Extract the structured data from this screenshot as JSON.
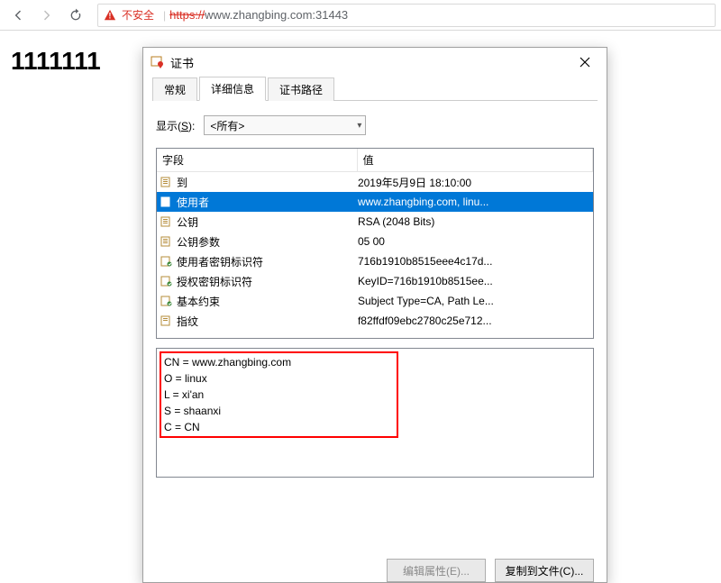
{
  "browser": {
    "insecure_label": "不安全",
    "url_scheme": "https://",
    "url_rest": "www.zhangbing.com:31443"
  },
  "page": {
    "headline": "1111111"
  },
  "dialog": {
    "title": "证书",
    "tabs": {
      "general": "常规",
      "details": "详细信息",
      "path": "证书路径"
    },
    "show_label_pre": "显示(",
    "show_label_u": "S",
    "show_label_post": "):",
    "show_value": "<所有>",
    "header_field": "字段",
    "header_value": "值",
    "rows": [
      {
        "field": "到",
        "value": "2019年5月9日 18:10:00",
        "icon": "file"
      },
      {
        "field": "使用者",
        "value": "www.zhangbing.com, linu...",
        "icon": "file",
        "selected": true
      },
      {
        "field": "公钥",
        "value": "RSA (2048 Bits)",
        "icon": "file"
      },
      {
        "field": "公钥参数",
        "value": "05 00",
        "icon": "file"
      },
      {
        "field": "使用者密钥标识符",
        "value": "716b1910b8515eee4c17d...",
        "icon": "ext"
      },
      {
        "field": "授权密钥标识符",
        "value": "KeyID=716b1910b8515ee...",
        "icon": "ext"
      },
      {
        "field": "基本约束",
        "value": "Subject Type=CA, Path Le...",
        "icon": "ext"
      },
      {
        "field": "指纹",
        "value": "f82ffdf09ebc2780c25e712...",
        "icon": "prop"
      }
    ],
    "detail_lines": [
      "CN = www.zhangbing.com",
      "O = linux",
      "L = xi'an",
      "S = shaanxi",
      "C = CN"
    ],
    "btn_edit": "编辑属性(E)...",
    "btn_copy": "复制到文件(C)..."
  }
}
